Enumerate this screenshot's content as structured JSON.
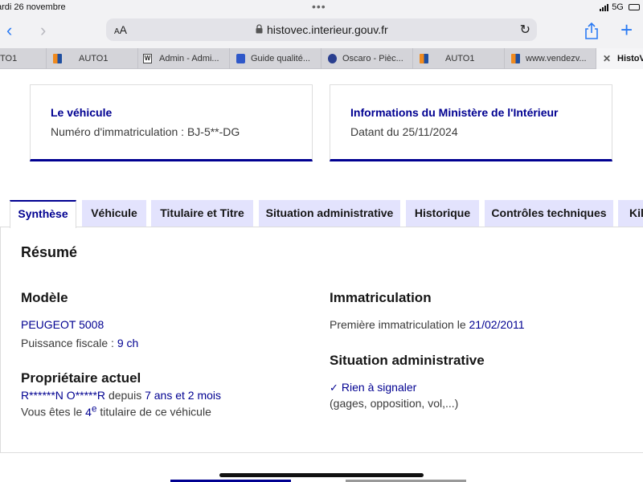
{
  "status_bar": {
    "time": "ardi 26 novembre",
    "dots": "•••",
    "network": "5G",
    "battery": "6"
  },
  "browser": {
    "aa_label": "AA",
    "url": "histovec.interieur.gouv.fr",
    "tabs": [
      {
        "label": "TO1",
        "icon": "orange-logo"
      },
      {
        "label": "AUTO1",
        "icon": "orange-logo"
      },
      {
        "label": "Admin - Admi...",
        "icon": "w-logo"
      },
      {
        "label": "Guide qualité...",
        "icon": "blue-logo"
      },
      {
        "label": "Oscaro - Pièc...",
        "icon": "oscaro-logo"
      },
      {
        "label": "AUTO1",
        "icon": "orange-logo"
      },
      {
        "label": "www.vendezv...",
        "icon": "orange-logo"
      },
      {
        "label": "HistoV",
        "icon": "close-icon"
      }
    ]
  },
  "vehicle_card": {
    "title": "Le véhicule",
    "text": "Numéro d'immatriculation : BJ-5**-DG"
  },
  "ministry_card": {
    "title": "Informations du Ministère de l'Intérieur",
    "text": "Datant du 25/11/2024"
  },
  "content_tabs": [
    "Synthèse",
    "Véhicule",
    "Titulaire et Titre",
    "Situation administrative",
    "Historique",
    "Contrôles techniques",
    "Kilo"
  ],
  "summary": {
    "title": "Résumé",
    "model": {
      "heading": "Modèle",
      "name": "PEUGEOT 5008",
      "power_label": "Puissance fiscale :",
      "power_value": "9 ch"
    },
    "owner": {
      "heading": "Propriétaire actuel",
      "name": "R******N O*****R",
      "since_label": "depuis",
      "since_value": "7 ans et 2 mois",
      "prefix": "Vous êtes le",
      "rank": "4",
      "rank_sup": "e",
      "suffix": "titulaire de ce véhicule"
    },
    "registration": {
      "heading": "Immatriculation",
      "label": "Première immatriculation le",
      "date": "21/02/2011"
    },
    "admin": {
      "heading": "Situation administrative",
      "status": "Rien à signaler",
      "detail": "(gages, opposition, vol,...)"
    }
  },
  "colors": {
    "primary": "#000091",
    "tab_bg": "#e3e3fd",
    "ios_blue": "#2a7af3"
  }
}
